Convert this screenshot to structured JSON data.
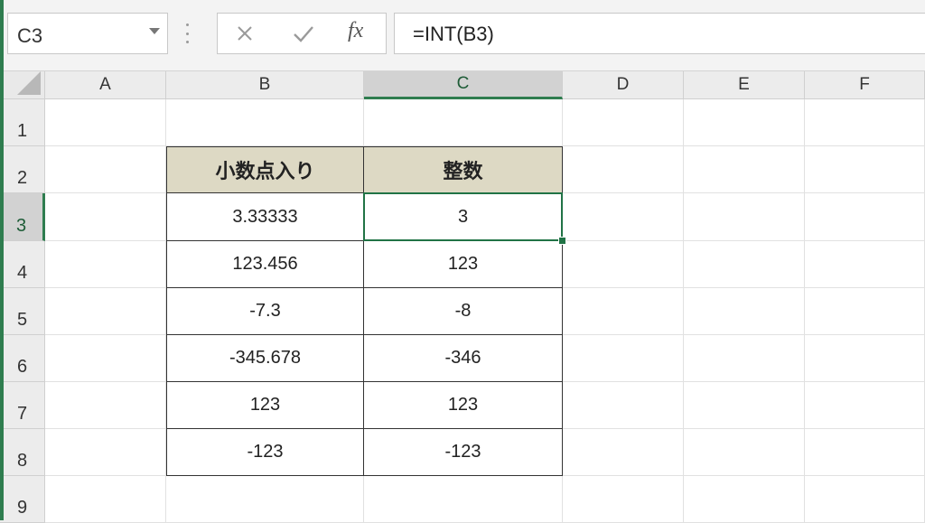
{
  "name_box": {
    "value": "C3"
  },
  "formula_bar": {
    "cancel_icon": "close-icon",
    "enter_icon": "check-icon",
    "fx_label": "fx",
    "formula": "=INT(B3)"
  },
  "columns": [
    "A",
    "B",
    "C",
    "D",
    "E",
    "F"
  ],
  "rows": [
    "1",
    "2",
    "3",
    "4",
    "5",
    "6",
    "7",
    "8",
    "9"
  ],
  "selected_cell": "C3",
  "table": {
    "headers": [
      "小数点入り",
      "整数"
    ],
    "rows": [
      [
        "3.33333",
        "3"
      ],
      [
        "123.456",
        "123"
      ],
      [
        "-7.3",
        "-8"
      ],
      [
        "-345.678",
        "-346"
      ],
      [
        "123",
        "123"
      ],
      [
        "-123",
        "-123"
      ]
    ]
  },
  "colors": {
    "accent": "#217346",
    "table_header_bg": "#ddd9c4"
  }
}
